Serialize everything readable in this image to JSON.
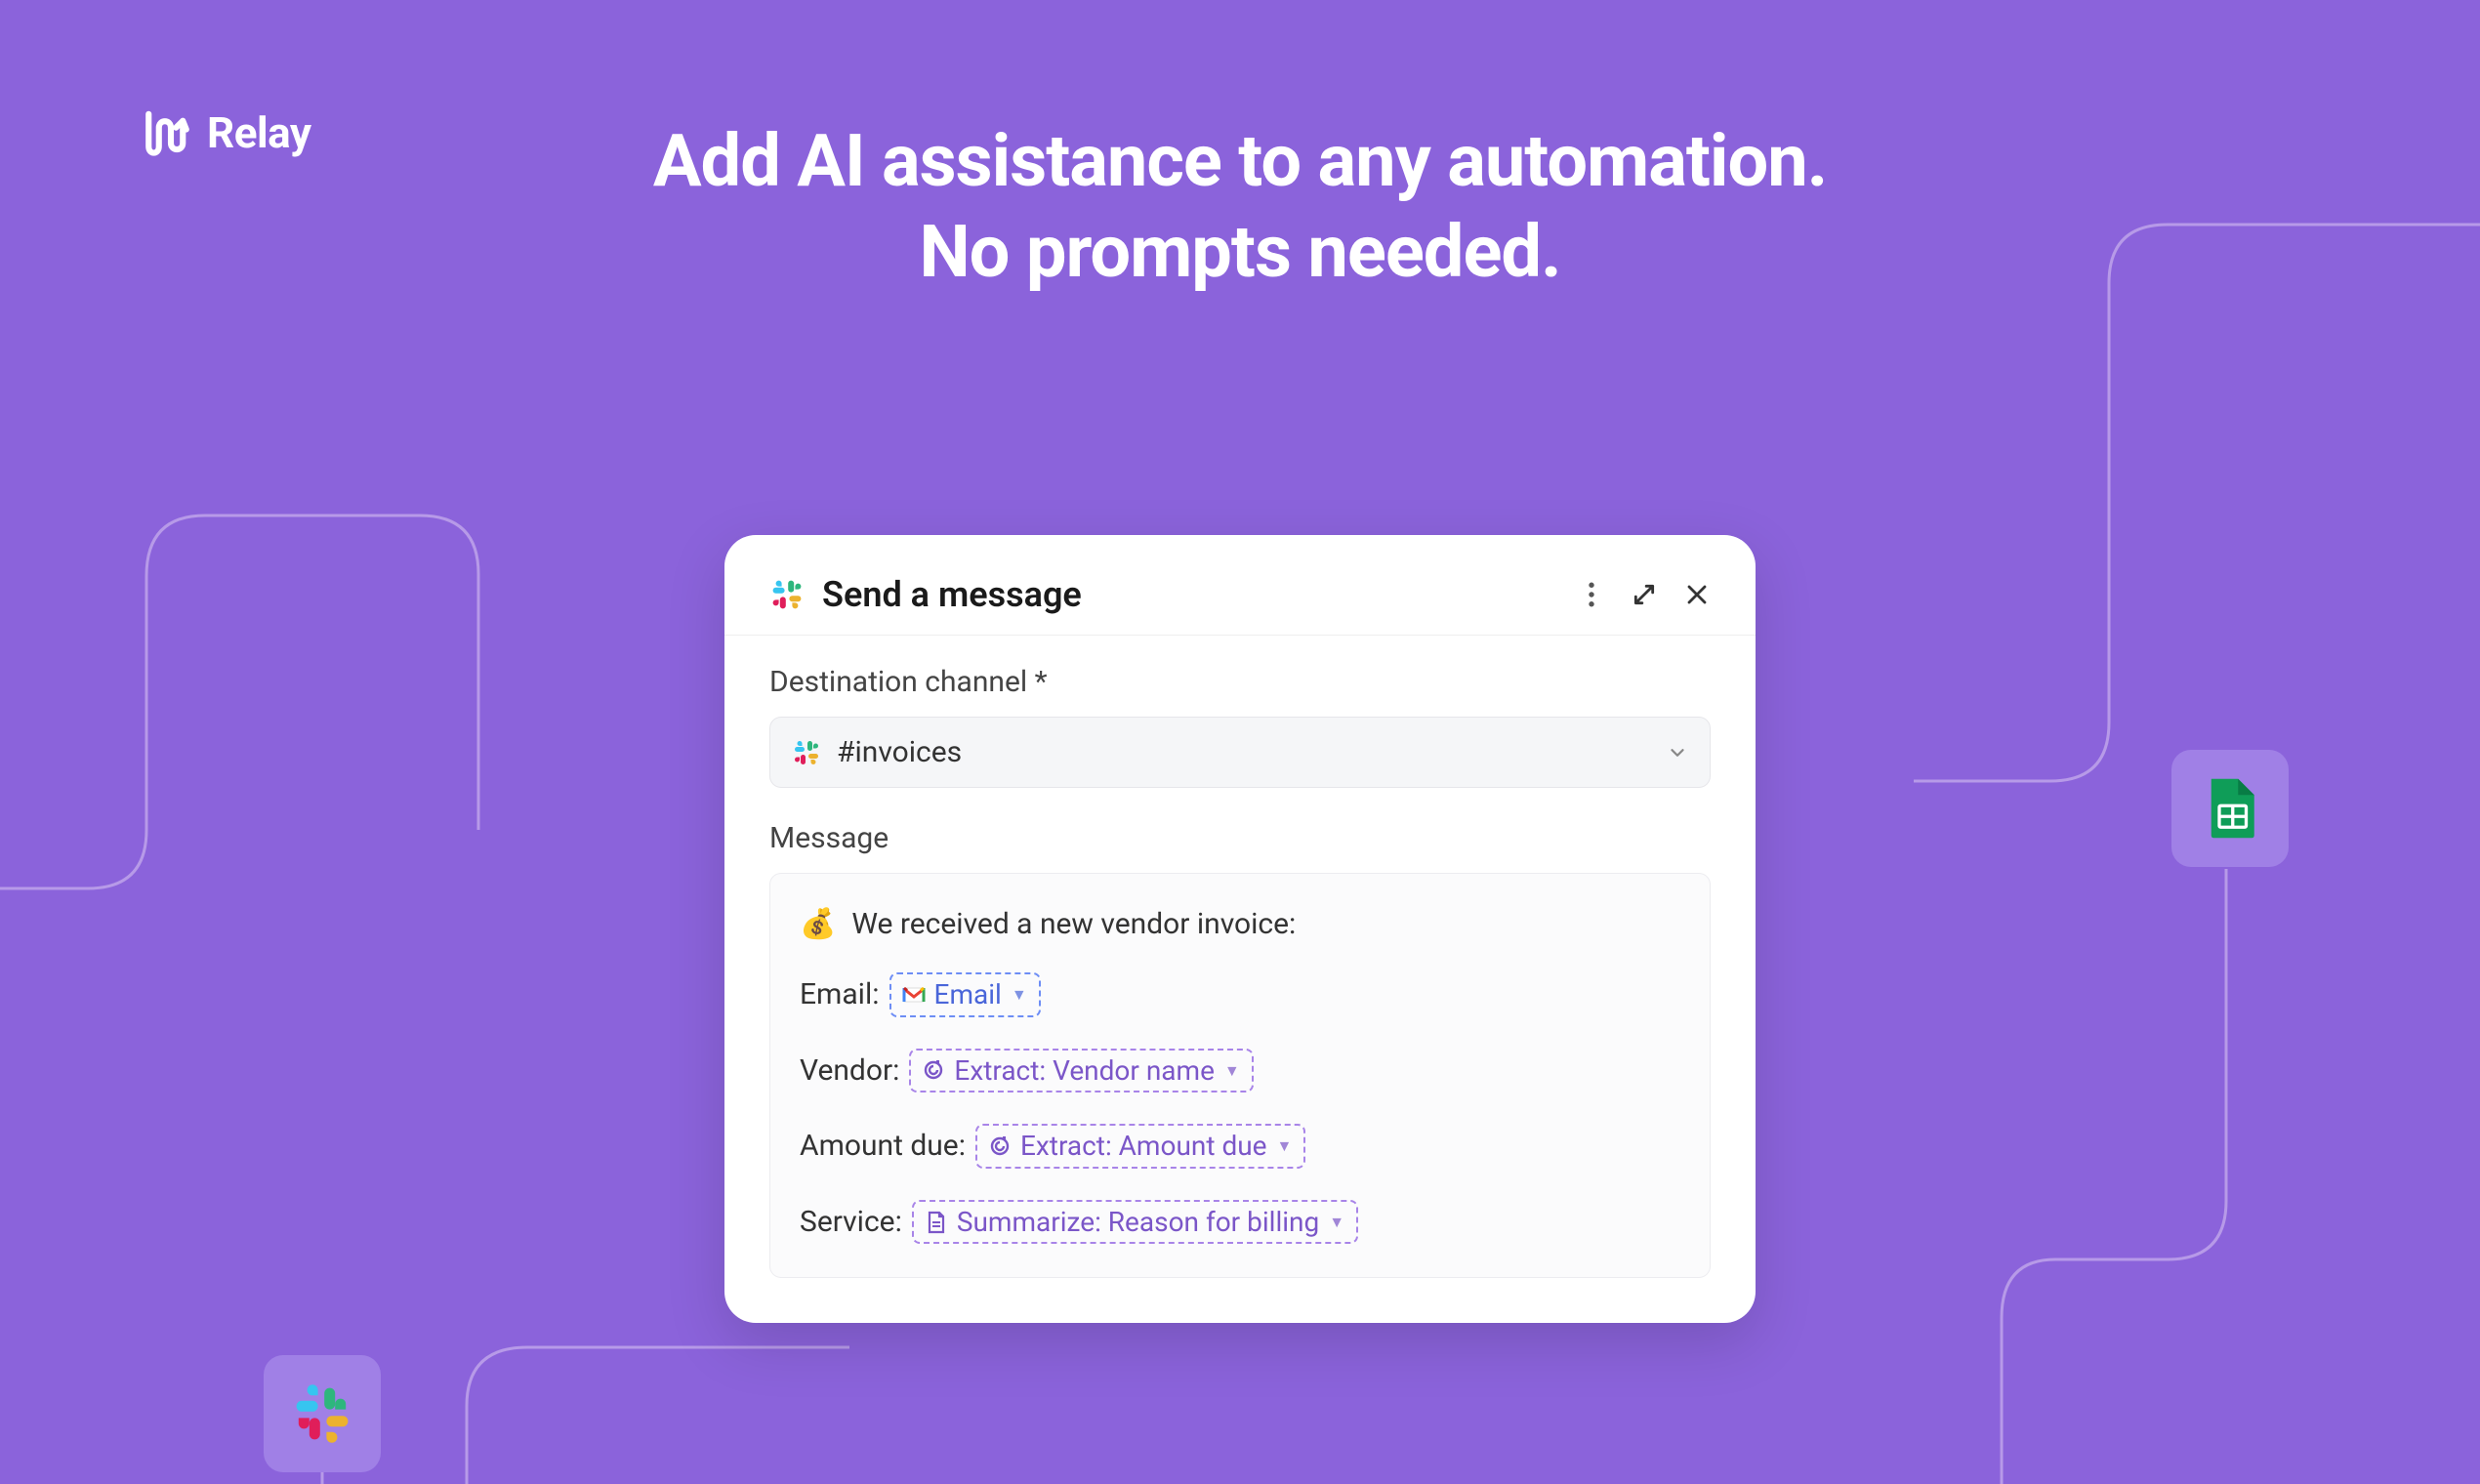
{
  "brand": {
    "name": "Relay"
  },
  "headline": {
    "line1": "Add AI assistance to any automation.",
    "line2": "No prompts needed."
  },
  "card": {
    "title": "Send a message",
    "destination_label": "Destination channel *",
    "destination_value": "#invoices",
    "message_label": "Message",
    "message": {
      "intro": "We received a new vendor invoice:",
      "email_label": "Email:",
      "email_chip": "Email",
      "vendor_label": "Vendor:",
      "vendor_chip": "Extract: Vendor name",
      "amount_label": "Amount due:",
      "amount_chip": "Extract: Amount due",
      "service_label": "Service:",
      "service_chip": "Summarize: Reason for billing"
    }
  },
  "icons": {
    "sheets": "google-sheets-icon",
    "slack": "slack-icon"
  }
}
